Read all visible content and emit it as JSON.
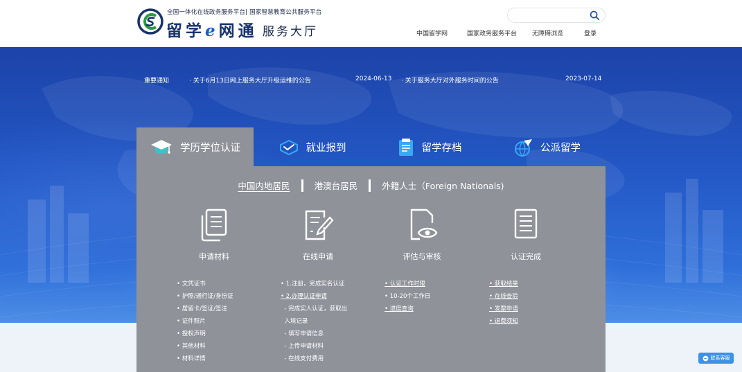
{
  "header": {
    "tagline": "全国一体化在线政务服务平台| 国家智慧教育公共服务平台",
    "brand_main": "留学",
    "brand_e": "e",
    "brand_tail": "网通",
    "brand_sub": "服务大厅",
    "search": {
      "placeholder": "",
      "value": ""
    },
    "nav": [
      {
        "label": "中国留学网"
      },
      {
        "label": "国家政务服务平台"
      },
      {
        "label": "无障碍浏览"
      },
      {
        "label": "登录"
      }
    ]
  },
  "notices": {
    "title": "重要通知",
    "items": [
      {
        "text": "· 关于6月13日网上服务大厅升级运维的公告",
        "date": "2024-06-13"
      },
      {
        "text": "· 关于服务大厅对外服务时间的公告",
        "date": "2023-07-14"
      }
    ]
  },
  "tabs": [
    {
      "label": "学历学位认证",
      "icon": "graduation-cap-icon",
      "active": true
    },
    {
      "label": "就业报到",
      "icon": "handshake-icon",
      "active": false
    },
    {
      "label": "留学存档",
      "icon": "archive-folder-icon",
      "active": false
    },
    {
      "label": "公派留学",
      "icon": "globe-plane-icon",
      "active": false
    }
  ],
  "sub_tabs": [
    {
      "label": "中国内地居民",
      "active": true
    },
    {
      "label": "港澳台居民",
      "active": false
    },
    {
      "label": "外籍人士（Foreign Nationals)",
      "active": false
    }
  ],
  "steps": [
    {
      "label": "申请材料",
      "icon": "documents-icon"
    },
    {
      "label": "在线申请",
      "icon": "edit-form-icon"
    },
    {
      "label": "评估与审核",
      "icon": "review-eye-icon"
    },
    {
      "label": "认证完成",
      "icon": "checklist-icon"
    }
  ],
  "columns": {
    "materials": [
      "• 文凭证书",
      "• 护照/通行证/身份证",
      "• 居留卡/签证/签注",
      "• 证件照片",
      "• 授权声明",
      "• 其他材料",
      "• 材料详情"
    ],
    "apply": [
      "• 1.注册，完成实名认证",
      "• 2.办理认证申请",
      "  - 完成实人认证，获取出",
      "  入境记录",
      "  - 填写申请信息",
      "  - 上传申请材料",
      "  - 在线支付费用"
    ],
    "review": [
      "• 认证工作时限",
      "• 10-20个工作日",
      "• 进度查询"
    ],
    "complete": [
      "• 获取结果",
      "• 在线查验",
      "• 发票申请",
      "• 退费须知"
    ]
  },
  "customer_service": {
    "label": "联系客服",
    "icon": "chat-bubble-icon"
  },
  "colors": {
    "brand_navy": "#17336b",
    "banner_blue": "#2358c6",
    "panel_gray": "#8f9299",
    "cs_button": "#3c92e6"
  }
}
